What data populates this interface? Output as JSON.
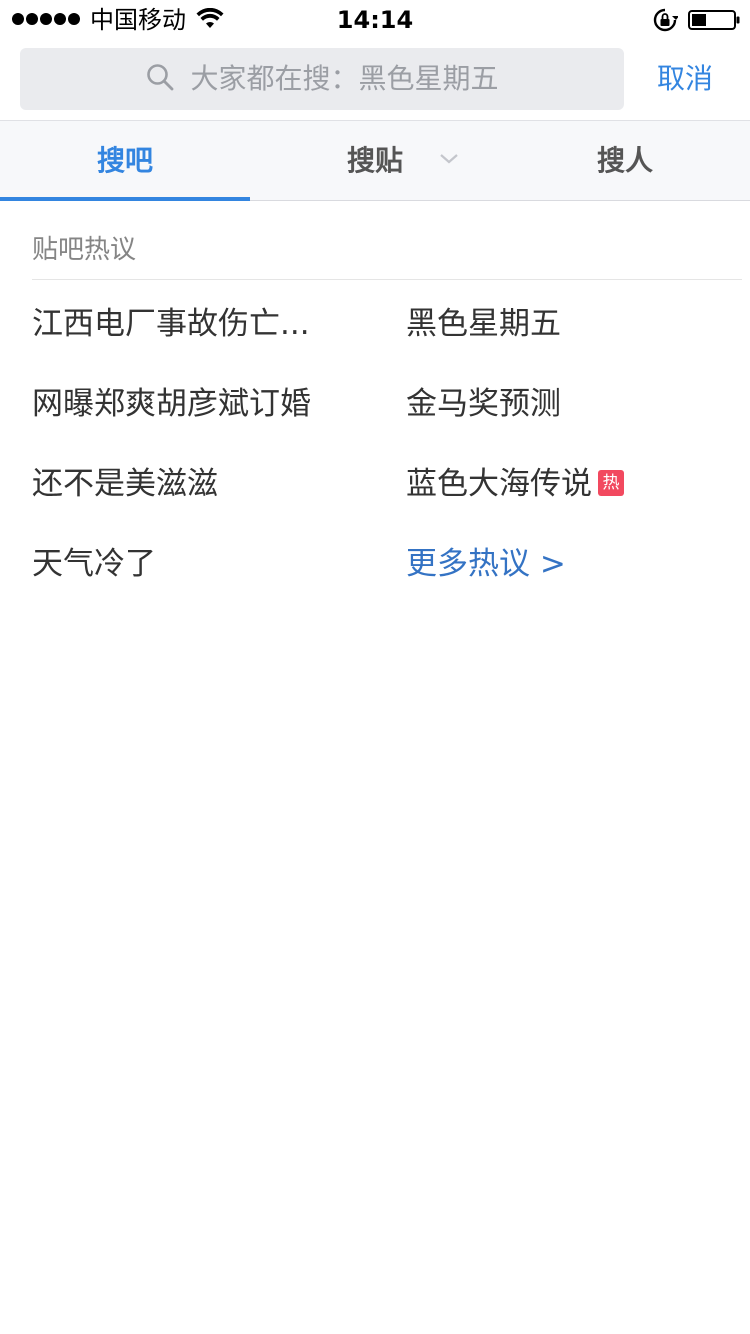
{
  "status_bar": {
    "carrier": "中国移动",
    "time": "14:14"
  },
  "search": {
    "placeholder": "大家都在搜：黑色星期五",
    "cancel_label": "取消"
  },
  "tabs": [
    {
      "label": "搜吧",
      "active": true
    },
    {
      "label": "搜贴",
      "active": false
    },
    {
      "label": "搜人",
      "active": false
    }
  ],
  "hot": {
    "title": "贴吧热议",
    "items": [
      {
        "label": "江西电厂事故伤亡..."
      },
      {
        "label": "黑色星期五"
      },
      {
        "label": "网曝郑爽胡彦斌订婚"
      },
      {
        "label": "金马奖预测"
      },
      {
        "label": "还不是美滋滋"
      },
      {
        "label": "蓝色大海传说",
        "badge": "热"
      },
      {
        "label": "天气冷了"
      }
    ],
    "more_label": "更多热议 >"
  },
  "colors": {
    "accent": "#3385e0",
    "hot_badge": "#f2495f",
    "more_link": "#3473c4"
  }
}
